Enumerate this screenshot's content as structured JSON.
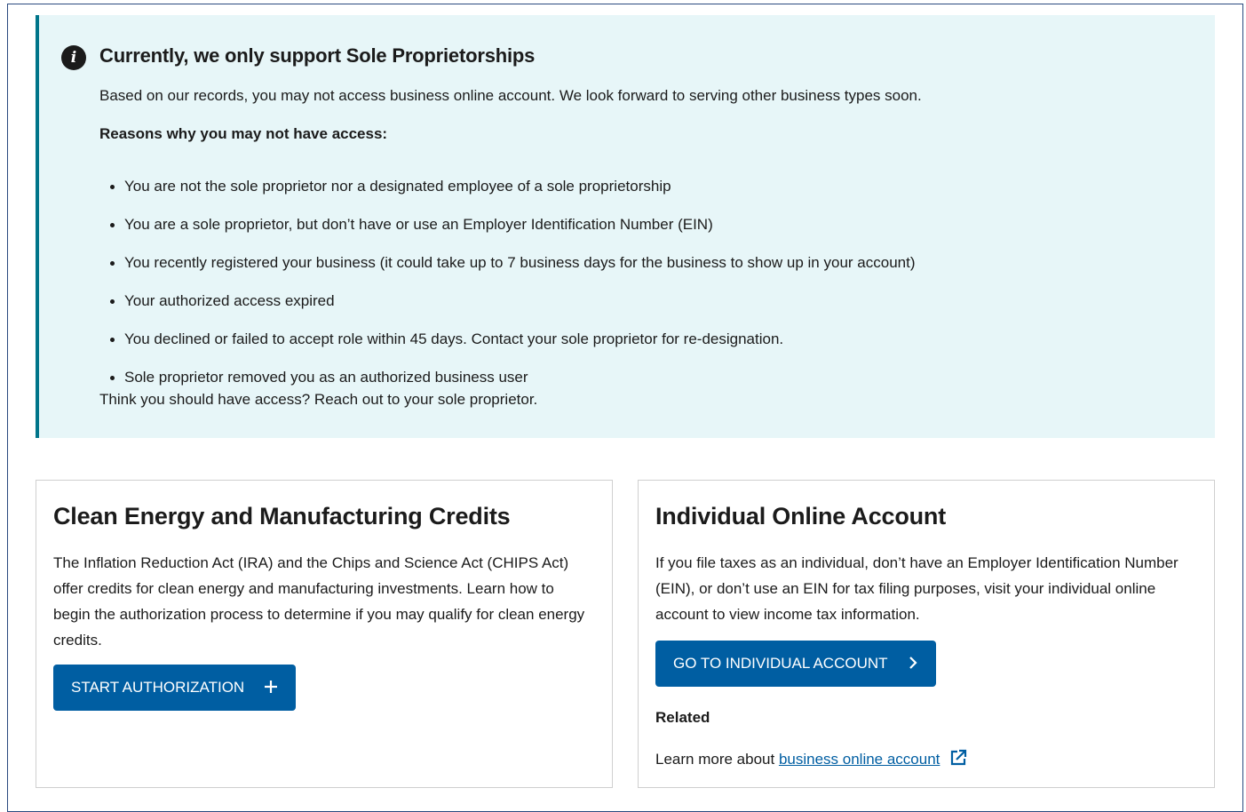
{
  "alert": {
    "icon": "info-icon",
    "title": "Currently, we only support Sole Proprietorships",
    "description": "Based on our records, you may not access business online account. We look forward to serving other business types soon.",
    "reasons_heading": "Reasons why you may not have access:",
    "reasons": [
      "You are not the sole proprietor nor a designated employee of a sole proprietorship",
      "You are a sole proprietor, but don’t have or use an Employer Identification Number (EIN)",
      "You recently registered your business (it could take up to 7 business days for the business to show up in your account)",
      "Your authorized access expired",
      "You declined or failed to accept role within 45 days. Contact your sole proprietor for re-designation.",
      "Sole proprietor removed you as an authorized business user"
    ],
    "footer": "Think you should have access? Reach out to your sole proprietor."
  },
  "clean_energy_card": {
    "title": "Clean Energy and Manufacturing Credits",
    "body": "The Inflation Reduction Act (IRA) and the Chips and Science Act (CHIPS Act) offer credits for clean energy and manufacturing investments. Learn how to begin the authorization process to determine if you may qualify for clean energy credits.",
    "button_label": "START AUTHORIZATION",
    "button_icon": "plus-icon"
  },
  "individual_card": {
    "title": "Individual Online Account",
    "body": "If you file taxes as an individual, don’t have an Employer Identification Number (EIN), or don’t use an EIN for tax filing purposes, visit your individual online account to view income tax information.",
    "button_label": "GO TO INDIVIDUAL ACCOUNT",
    "button_icon": "chevron-right-icon",
    "related_label": "Related",
    "learn_more_prefix": "Learn more about",
    "learn_more_link": "business online account",
    "link_icon": "external-link-icon"
  },
  "colors": {
    "alert_background": "#e7f6f8",
    "alert_border": "#00758a",
    "button_primary": "#005ea2",
    "link": "#005ea2",
    "card_border": "#cfcfcf"
  }
}
